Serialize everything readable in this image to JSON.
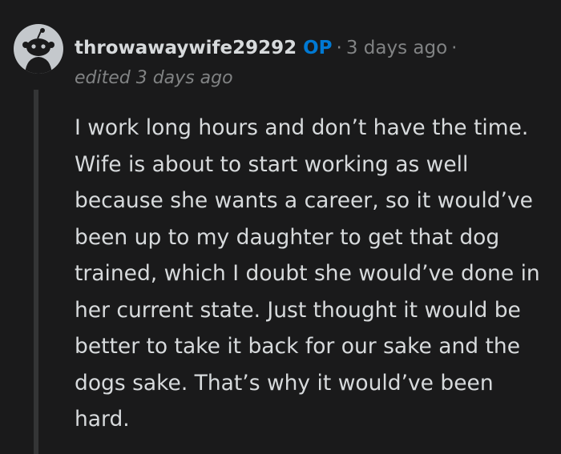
{
  "comment": {
    "author": "throwawaywife29292",
    "op_badge": "OP",
    "separator": "·",
    "timestamp": "3 days ago",
    "edited": "edited 3 days ago",
    "body": "I work long hours and don’t have the time. Wife is about to start working as well because she wants a career, so it would’ve been up to my daughter to get that dog trained, which I doubt she would’ve done in her current state. Just thought it would be better to take it back for our sake and the dogs sake. That’s why it would’ve been hard.",
    "avatar_icon": "snoo-avatar-icon"
  },
  "colors": {
    "background": "#1a1a1b",
    "text": "#d7dadc",
    "muted": "#818384",
    "op_badge": "#0079d3",
    "thread_line": "#343536",
    "avatar_bg": "#c4c8cc"
  }
}
